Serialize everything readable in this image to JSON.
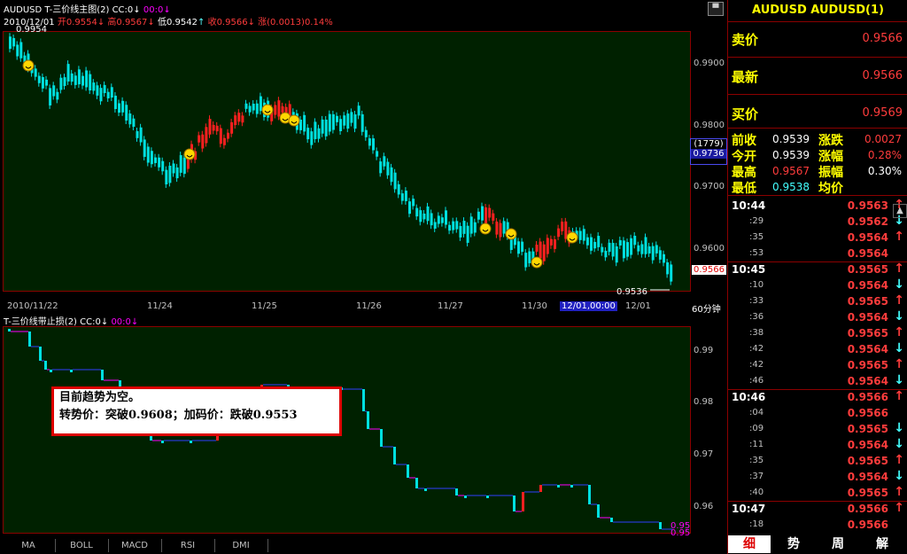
{
  "main_chart": {
    "title": "AUDUSD T-三价线主图(2)",
    "cc_label": "CC:0",
    "cc_value": "00:0",
    "date": "2010/12/01",
    "open_label": "开",
    "open_value": "0.9554",
    "high_label": "高",
    "high_value": "0.9567",
    "low_label": "低",
    "low_value": "0.9542",
    "close_label": "收",
    "close_value": "0.9566",
    "change_label": "涨",
    "change_value": "(0.0013)",
    "change_pct": "0.14%",
    "top_mark": "0.9954",
    "low_mark": "0.9536",
    "y_ticks": [
      "0.9900",
      "0.9800",
      "0.9700",
      "0.9600"
    ],
    "cursor_count": "(1779)",
    "cursor_price": "0.9736",
    "last_price_tag": "0.9566",
    "period": "60分钟"
  },
  "x_axis": {
    "dates": [
      "2010/11/22",
      "11/24",
      "11/25",
      "11/26",
      "11/27",
      "11/30",
      "12/01,00:00",
      "12/01"
    ]
  },
  "sub_chart": {
    "title": "T-三价线带止损(2)",
    "cc_label": "CC:0",
    "cc_value": "00:0",
    "y_ticks": [
      "0.99",
      "0.98",
      "0.97",
      "0.96"
    ],
    "end_values": [
      "0.95",
      "0.95"
    ]
  },
  "info_box": {
    "line1": "目前趋势为空。",
    "line2": "转势价：突破0.9608；加码价：跌破0.9553"
  },
  "bottom_tabs": [
    "MA",
    "BOLL",
    "MACD",
    "RSI",
    "DMI"
  ],
  "quote": {
    "symbol": "AUDUSD AUDUSD(1)",
    "sell_label": "卖价",
    "sell_value": "0.9566",
    "latest_label": "最新",
    "latest_value": "0.9566",
    "buy_label": "买价",
    "buy_value": "0.9569",
    "stats": [
      {
        "l1": "前收",
        "v1": "0.9539",
        "l2": "涨跌",
        "v2": "0.0027"
      },
      {
        "l1": "今开",
        "v1": "0.9539",
        "l2": "涨幅",
        "v2": "0.28%"
      },
      {
        "l1": "最高",
        "v1": "0.9567",
        "l2": "振幅",
        "v2": "0.30%"
      },
      {
        "l1": "最低",
        "v1": "0.9538",
        "l2": "均价",
        "v2": ""
      }
    ],
    "ticks": [
      {
        "time": "10:44",
        "big": true,
        "price": "0.9563",
        "dir": "up"
      },
      {
        "time": ":29",
        "big": false,
        "price": "0.9562",
        "dir": "down"
      },
      {
        "time": ":35",
        "big": false,
        "price": "0.9564",
        "dir": "up"
      },
      {
        "time": ":53",
        "big": false,
        "price": "0.9564",
        "dir": ""
      },
      {
        "time": "10:45",
        "big": true,
        "price": "0.9565",
        "dir": "up"
      },
      {
        "time": ":10",
        "big": false,
        "price": "0.9564",
        "dir": "down"
      },
      {
        "time": ":33",
        "big": false,
        "price": "0.9565",
        "dir": "up"
      },
      {
        "time": ":36",
        "big": false,
        "price": "0.9564",
        "dir": "down"
      },
      {
        "time": ":38",
        "big": false,
        "price": "0.9565",
        "dir": "up"
      },
      {
        "time": ":42",
        "big": false,
        "price": "0.9564",
        "dir": "down"
      },
      {
        "time": ":42",
        "big": false,
        "price": "0.9565",
        "dir": "up"
      },
      {
        "time": ":46",
        "big": false,
        "price": "0.9564",
        "dir": "down"
      },
      {
        "time": "10:46",
        "big": true,
        "price": "0.9566",
        "dir": "up"
      },
      {
        "time": ":04",
        "big": false,
        "price": "0.9566",
        "dir": ""
      },
      {
        "time": ":09",
        "big": false,
        "price": "0.9565",
        "dir": "down"
      },
      {
        "time": ":11",
        "big": false,
        "price": "0.9564",
        "dir": "down"
      },
      {
        "time": ":35",
        "big": false,
        "price": "0.9565",
        "dir": "up"
      },
      {
        "time": ":37",
        "big": false,
        "price": "0.9564",
        "dir": "down"
      },
      {
        "time": ":40",
        "big": false,
        "price": "0.9565",
        "dir": "up"
      },
      {
        "time": "10:47",
        "big": true,
        "price": "0.9566",
        "dir": "up"
      },
      {
        "time": ":18",
        "big": false,
        "price": "0.9566",
        "dir": ""
      }
    ],
    "tabs": [
      "细",
      "势",
      "周",
      "解"
    ],
    "colors": {
      "up": "#ff3c3c",
      "down": "#4ff",
      "label": "#ffff00",
      "price": "#ff3c3c"
    }
  }
}
